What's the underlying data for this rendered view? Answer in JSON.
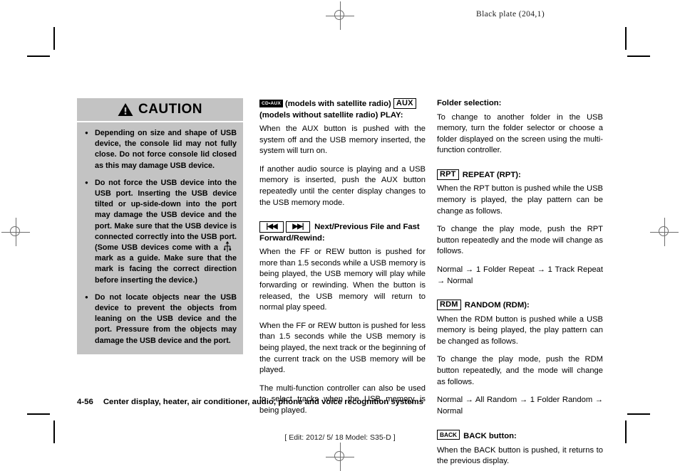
{
  "page": {
    "plate_label": "Black plate (204,1)",
    "footer_page_number": "4-56",
    "footer_chapter": "Center display, heater, air conditioner, audio, phone and voice recognition systems",
    "edit_line": "[ Edit: 2012/ 5/ 18   Model:  S35-D ]"
  },
  "caution": {
    "title": "CAUTION",
    "icon": "warning-triangle-icon",
    "bg_color": "#c3c3c3",
    "items": [
      "Depending on size and shape of USB device, the console lid may not fully close. Do not force console lid closed as this may damage USB device.",
      {
        "before": "Do not force the USB device into the USB port. Inserting the USB device tilted or up-side-down into the port may damage the USB device and the port. Make sure that the USB device is connected correctly into the USB port. (Some USB devices come with a",
        "symbol": "usb-trident-icon",
        "after": "mark as a guide. Make sure that the mark is facing the correct direction before inserting the device.)"
      },
      "Do not locate objects near the USB device to prevent the objects from leaning on the USB device and the port. Pressure from the objects may damage the USB device and the port."
    ]
  },
  "middle_column": {
    "play_section": {
      "chip_cd_aux": "CD•AUX",
      "heading_part_1": "(models with satellite radio)",
      "chip_aux": "AUX",
      "heading_part_2": "(models without satellite radio) PLAY:",
      "paragraphs": [
        "When the AUX button is pushed with the system off and the USB memory inserted, the system will turn on.",
        "If another audio source is playing and a USB memory is inserted, push the AUX button repeatedly until the center display changes to the USB memory mode."
      ]
    },
    "nav_section": {
      "chip_prev": "|◀◀",
      "chip_next": "▶▶|",
      "heading": "Next/Previous File and Fast Forward/Rewind:",
      "paragraphs": [
        "When the FF or REW button is pushed for more than 1.5 seconds while a USB memory is being played, the USB memory will play while forwarding or rewinding. When the button is released, the USB memory will return to normal play speed.",
        "When the FF or REW button is pushed for less than 1.5 seconds while the USB memory is being played, the next track or the beginning of the current track on the USB memory will be played.",
        "The multi-function controller can also be used to select tracks when the USB memory is being played."
      ]
    }
  },
  "right_column": {
    "folder_section": {
      "heading": "Folder selection:",
      "paragraphs": [
        "To change to another folder in the USB memory, turn the folder selector or choose a folder displayed on the screen using the multi-function controller."
      ]
    },
    "repeat_section": {
      "chip": "RPT",
      "heading": "REPEAT (RPT):",
      "paragraphs": [
        "When the RPT button is pushed while the USB memory is played, the play pattern can be change as follows.",
        "To change the play mode, push the RPT button repeatedly and the mode will change as follows.",
        "Normal → 1 Folder Repeat → 1 Track Repeat → Normal"
      ]
    },
    "random_section": {
      "chip": "RDM",
      "heading": "RANDOM (RDM):",
      "paragraphs": [
        "When the RDM button is pushed while a USB memory is being played, the play pattern can be changed as follows.",
        "To change the play mode, push the RDM button repeatedly, and the mode will change as follows.",
        "Normal → All Random → 1 Folder Random → Normal"
      ]
    },
    "back_section": {
      "chip": "BACK",
      "heading": "BACK button:",
      "paragraphs": [
        "When the BACK button is pushed, it returns to the previous display."
      ]
    }
  }
}
